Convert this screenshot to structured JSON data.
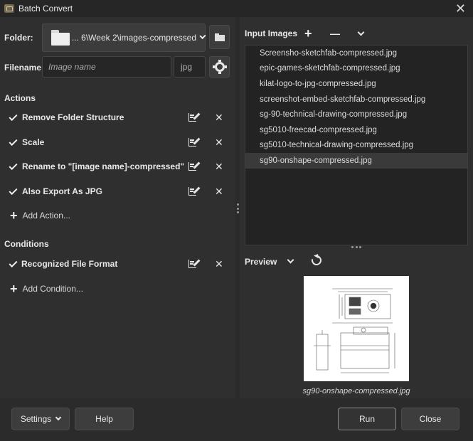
{
  "window": {
    "title": "Batch Convert",
    "close_glyph": "✕"
  },
  "folder": {
    "label": "Folder:",
    "path": "... 6\\Week 2\\images-compressed"
  },
  "filename": {
    "label": "Filename:",
    "placeholder": "Image name",
    "extension": "jpg"
  },
  "actions": {
    "heading": "Actions",
    "items": [
      {
        "label": "Remove Folder Structure",
        "checked": true
      },
      {
        "label": "Scale",
        "checked": true
      },
      {
        "label": "Rename to \"[image name]-compressed\"",
        "checked": true
      },
      {
        "label": "Also Export As JPG",
        "checked": true
      }
    ],
    "add_label": "Add Action..."
  },
  "conditions": {
    "heading": "Conditions",
    "items": [
      {
        "label": "Recognized File Format",
        "checked": true
      }
    ],
    "add_label": "Add Condition..."
  },
  "input_images": {
    "heading": "Input Images",
    "add_glyph": "+",
    "remove_glyph": "—",
    "files": [
      "Screensho-sketchfab-compressed.jpg",
      "epic-games-sketchfab-compressed.jpg",
      "kilat-logo-to-jpg-compressed.jpg",
      "screenshot-embed-sketchfab-compressed.jpg",
      "sg-90-technical-drawing-compressed.jpg",
      "sg5010-freecad-compressed.jpg",
      "sg5010-technical-drawing-compressed.jpg",
      "sg90-onshape-compressed.jpg"
    ],
    "selected_index": 7
  },
  "preview": {
    "heading": "Preview",
    "caption": "sg90-onshape-compressed.jpg"
  },
  "footer": {
    "settings": "Settings",
    "help": "Help",
    "run": "Run",
    "close": "Close"
  },
  "icons": {
    "app": "app-icon",
    "folder": "folder-icon",
    "open_folder": "folder-open-icon",
    "settings": "gear-icon",
    "edit": "edit-icon",
    "remove": "close-icon",
    "refresh": "refresh-icon"
  }
}
